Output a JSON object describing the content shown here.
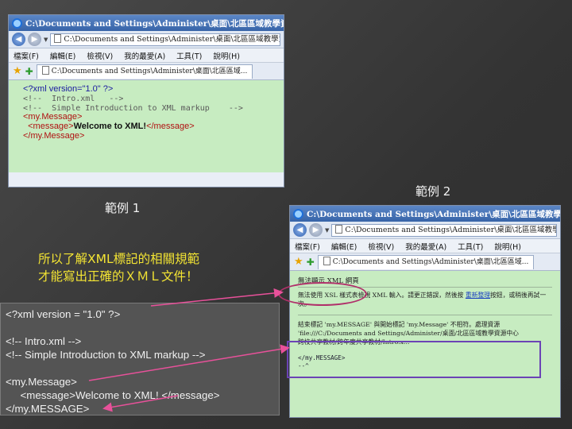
{
  "slide": {
    "label1": "範例 1",
    "label2": "範例 2",
    "yellow_lines": [
      "所以了解XML標記的相關規範",
      "才能寫出正確的ＸＭＬ文件！"
    ]
  },
  "code_panel": {
    "lines": [
      "<?xml version = \"1.0\" ?>",
      "",
      "<!-- Intro.xml -->",
      "<!-- Simple Introduction to XML markup -->",
      "",
      "<my.Message>",
      "     <message>Welcome to XML! </message>",
      "</my.MESSAGE>"
    ]
  },
  "browser1": {
    "title": "C:\\Documents and Settings\\Administer\\桌面\\北區區域教學資源中心跨",
    "address": "C:\\Documents and Settings\\Administer\\桌面\\北區區域教學資源",
    "menus": [
      "檔案(F)",
      "編輯(E)",
      "檢視(V)",
      "我的最愛(A)",
      "工具(T)",
      "說明(H)"
    ],
    "tab": "C:\\Documents and Settings\\Administer\\桌面\\北區區域...",
    "xml": {
      "decl": "<?xml version=\"1.0\" ?>",
      "c1": "<!--  Intro.xml   -->",
      "c2": "<!--  Simple Introduction to XML markup    -->",
      "root_open": "<my.Message>",
      "msg_open": "  <message>",
      "msg_text": "Welcome to XML!",
      "msg_close": "</message>",
      "root_close": "</my.Message>"
    }
  },
  "browser2": {
    "title": "C:\\Documents and Settings\\Administer\\桌面\\北區區域教學資源中心跨校共享",
    "address": "C:\\Documents and Settings\\Administer\\桌面\\北區區域教學資源中心",
    "menus": [
      "檔案(F)",
      "編輯(E)",
      "檢視(V)",
      "我的最愛(A)",
      "工具(T)",
      "說明(H)"
    ],
    "tab": "C:\\Documents and Settings\\Administer\\桌面\\北區區域...",
    "error": {
      "title": "無法顯示 XML 網頁",
      "text1": "無法使用 XSL 樣式表檢視 XML 輸入。請更正錯誤，然後按",
      "link": "重新整理",
      "text2": "按鈕，或稍後再試一次。",
      "line1": "結束標記 'my.MESSAGE' 與開始標記 'my.Message' 不相符。處理資源",
      "line2": "'file:///C:/Documents and Settings/Administer/桌面/北區區域教學資源中心",
      "line3": "跨校共享教材/跨年度共享教材/Intro.x...",
      "src1": "</my.MESSAGE>",
      "src2": "--^"
    }
  }
}
